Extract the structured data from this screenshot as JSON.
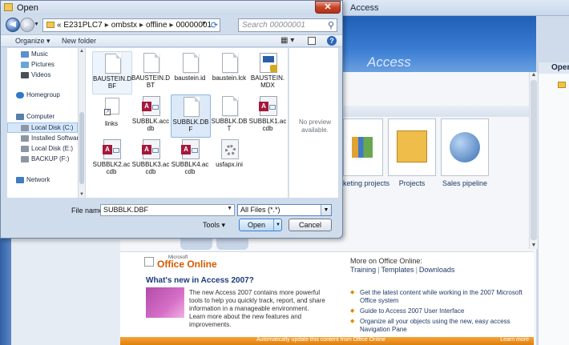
{
  "background_window": {
    "title": "Access",
    "header_title": "Access",
    "right_panel_header": "Open",
    "templates": [
      {
        "caption": "keting projects"
      },
      {
        "caption": "Projects"
      },
      {
        "caption": "Sales pipeline"
      }
    ],
    "office_online": {
      "logo_small": "Microsoft",
      "logo": "Office Online",
      "whats_new_title": "What's new in Access 2007?",
      "promo_text": "The new Access 2007 contains more powerful tools to help you quickly track, report, and share information in a manageable environment. Learn more about the new features and improvements.",
      "more_title": "More on Office Online:",
      "links": [
        "Training",
        "Templates",
        "Downloads"
      ],
      "bullets": [
        "Get the latest content while working in the 2007 Microsoft Office system",
        "Guide to Access 2007 User Interface",
        "Organize all your objects using the new, easy access Navigation Pane"
      ],
      "bottom_bar": "Automatically update this content from Office Online",
      "learn_more": "Learn more"
    }
  },
  "dialog": {
    "title": "Open",
    "close_glyph": "✕",
    "address": {
      "prefix": "«",
      "segments": [
        "E231PLC7",
        "ombstx",
        "offline",
        "00000001"
      ]
    },
    "search_placeholder": "Search 00000001",
    "toolbar": {
      "organize": "Organize ▾",
      "new_folder": "New folder"
    },
    "nav_items": [
      {
        "label": "Music",
        "icon": "music-icon",
        "color": "#5b8fd0"
      },
      {
        "label": "Pictures",
        "icon": "pictures-icon",
        "color": "#6aa5d8"
      },
      {
        "label": "Videos",
        "icon": "videos-icon",
        "color": "#4b4f57"
      },
      {
        "label": "Homegroup",
        "icon": "homegroup-icon",
        "color": "#2f79c8"
      },
      {
        "label": "Computer",
        "icon": "computer-icon",
        "color": "#5a7fa8"
      },
      {
        "label": "Local Disk (C:)",
        "icon": "drive-icon",
        "color": "#8d97a3"
      },
      {
        "label": "Installed Software",
        "icon": "drive-icon",
        "color": "#8d97a3"
      },
      {
        "label": "Local Disk (E:)",
        "icon": "drive-icon",
        "color": "#8d97a3"
      },
      {
        "label": "BACKUP (F:)",
        "icon": "drive-icon",
        "color": "#8d97a3"
      },
      {
        "label": "Network",
        "icon": "network-icon",
        "color": "#3f7cc0"
      }
    ],
    "files": [
      {
        "name": "BAUSTEIN.DBF",
        "type": "doc"
      },
      {
        "name": "BAUSTEIN.DBT",
        "type": "doc"
      },
      {
        "name": "baustein.id",
        "type": "doc"
      },
      {
        "name": "baustein.lck",
        "type": "doc"
      },
      {
        "name": "BAUSTEIN.MDX",
        "type": "mdx"
      },
      {
        "name": "links",
        "type": "lnk"
      },
      {
        "name": "SUBBLK.accdb",
        "type": "acc"
      },
      {
        "name": "SUBBLK.DBF",
        "type": "doc"
      },
      {
        "name": "SUBBLK.DBT",
        "type": "doc"
      },
      {
        "name": "SUBBLK1.accdb",
        "type": "acc"
      },
      {
        "name": "SUBBLK2.accdb",
        "type": "acc"
      },
      {
        "name": "SUBBLK3.accdb",
        "type": "acc"
      },
      {
        "name": "SUBBLK4.accdb",
        "type": "acc"
      },
      {
        "name": "usfapx.ini",
        "type": "ini"
      }
    ],
    "preview_text": "No preview available.",
    "file_name_label": "File name:",
    "file_name_value": "SUBBLK.DBF",
    "filter_value": "All Files (*.*)",
    "tools_label": "Tools ▾",
    "open_label": "Open",
    "cancel_label": "Cancel"
  }
}
